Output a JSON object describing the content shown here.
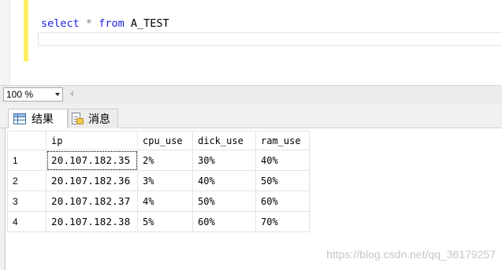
{
  "editor": {
    "query_tokens": {
      "select_kw": "select",
      "star": "*",
      "from_kw": "from",
      "table_name": "A_TEST"
    },
    "colors": {
      "keyword": "#1c1ce0",
      "operator": "#7f7f7f",
      "change_bar": "#ffee62"
    }
  },
  "zoom": {
    "value": "100 %"
  },
  "tabs": {
    "results_label": "结果",
    "messages_label": "消息",
    "results_icon": "grid-icon",
    "messages_icon": "message-icon"
  },
  "results": {
    "columns": [
      "ip",
      "cpu_use",
      "dick_use",
      "ram_use"
    ],
    "rows": [
      {
        "num": "1",
        "ip": "20.107.182.35",
        "cpu_use": "2%",
        "dick_use": "30%",
        "ram_use": "40%"
      },
      {
        "num": "2",
        "ip": "20.107.182.36",
        "cpu_use": "3%",
        "dick_use": "40%",
        "ram_use": "50%"
      },
      {
        "num": "3",
        "ip": "20.107.182.37",
        "cpu_use": "4%",
        "dick_use": "50%",
        "ram_use": "60%"
      },
      {
        "num": "4",
        "ip": "20.107.182.38",
        "cpu_use": "5%",
        "dick_use": "60%",
        "ram_use": "70%"
      }
    ]
  },
  "watermark": "https://blog.csdn.net/qq_36179257"
}
